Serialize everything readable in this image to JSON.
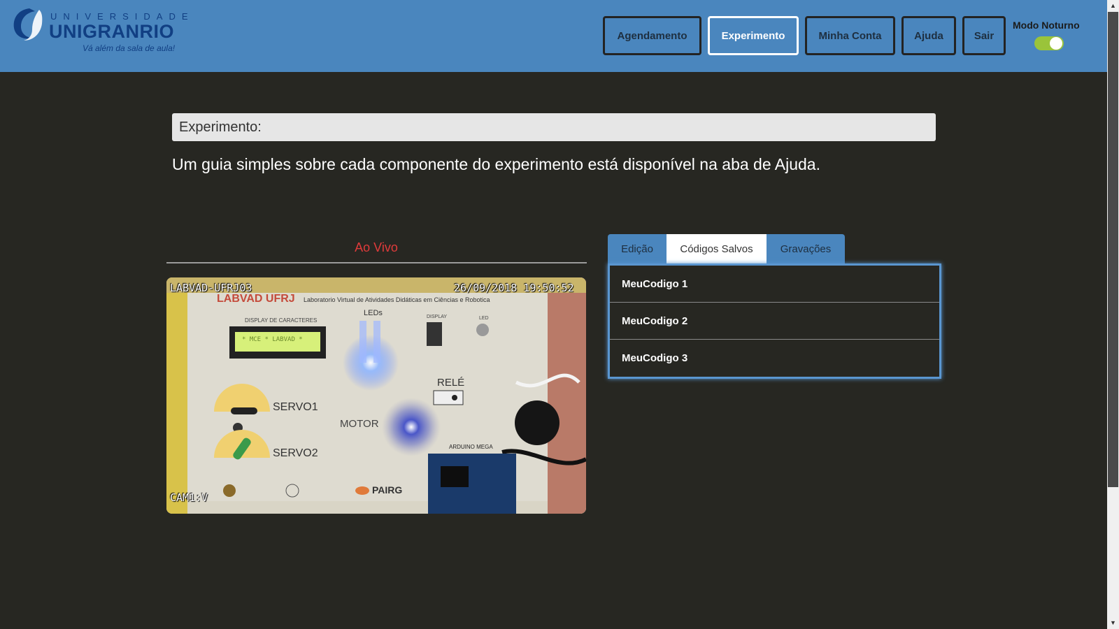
{
  "header": {
    "logo": {
      "univ": "UNIVERSIDADE",
      "name": "UNIGRANRIO",
      "tagline": "Vá além da sala de aula!"
    },
    "nav": [
      {
        "label": "Agendamento",
        "active": false
      },
      {
        "label": "Experimento",
        "active": true
      },
      {
        "label": "Minha Conta",
        "active": false
      },
      {
        "label": "Ajuda",
        "active": false
      },
      {
        "label": "Sair",
        "active": false
      }
    ],
    "night_mode": {
      "label": "Modo Noturno",
      "on": true
    }
  },
  "main": {
    "experiment_label": "Experimento:",
    "guide_text": "Um guia simples sobre cada componente do experimento está disponível na aba de Ajuda."
  },
  "live": {
    "label": "Ao Vivo",
    "camera_name": "LABVAD-UFRJ03",
    "timestamp": "26/09/2018 19:50:52",
    "camera_id": "CAM1:V",
    "board": {
      "title": "LABVAD UFRJ",
      "subtitle": "Laboratorio Virtual de Atividades Didáticas em Ciências e Robotica",
      "display_label": "DISPLAY DE CARACTERES",
      "lcd_text": "* MCE * LABVAD *",
      "leds_label": "LEDs",
      "display7_label": "DISPLAY",
      "led_label": "LED",
      "servo1": "SERVO1",
      "servo2": "SERVO2",
      "motor": "MOTOR",
      "rele": "RELÉ",
      "arduino": "ARDUINO MEGA",
      "sponsor": "PAIRG"
    }
  },
  "panel": {
    "tabs": [
      {
        "label": "Edição",
        "active": false
      },
      {
        "label": "Códigos Salvos",
        "active": true
      },
      {
        "label": "Gravações",
        "active": false
      }
    ],
    "saved_codes": [
      "MeuCodigo 1",
      "MeuCodigo 2",
      "MeuCodigo 3"
    ]
  },
  "colors": {
    "header_bg": "#4a86be",
    "page_bg": "#272722",
    "live_red": "#e03b3b",
    "toggle_on": "#9ac43a",
    "logo_blue": "#113f83"
  }
}
